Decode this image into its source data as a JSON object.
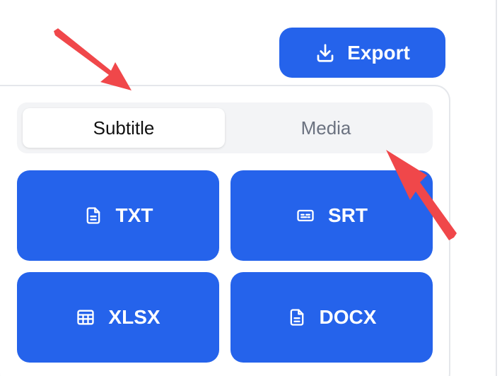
{
  "export_button": {
    "label": "Export",
    "icon": "download-icon"
  },
  "tabs": [
    {
      "label": "Subtitle",
      "active": true
    },
    {
      "label": "Media",
      "active": false
    }
  ],
  "formats": [
    {
      "label": "TXT",
      "icon": "document-icon"
    },
    {
      "label": "SRT",
      "icon": "captions-icon"
    },
    {
      "label": "XLSX",
      "icon": "table-icon"
    },
    {
      "label": "DOCX",
      "icon": "document-icon"
    }
  ],
  "colors": {
    "accent": "#2563eb",
    "annotation_arrow": "#f0474a"
  }
}
